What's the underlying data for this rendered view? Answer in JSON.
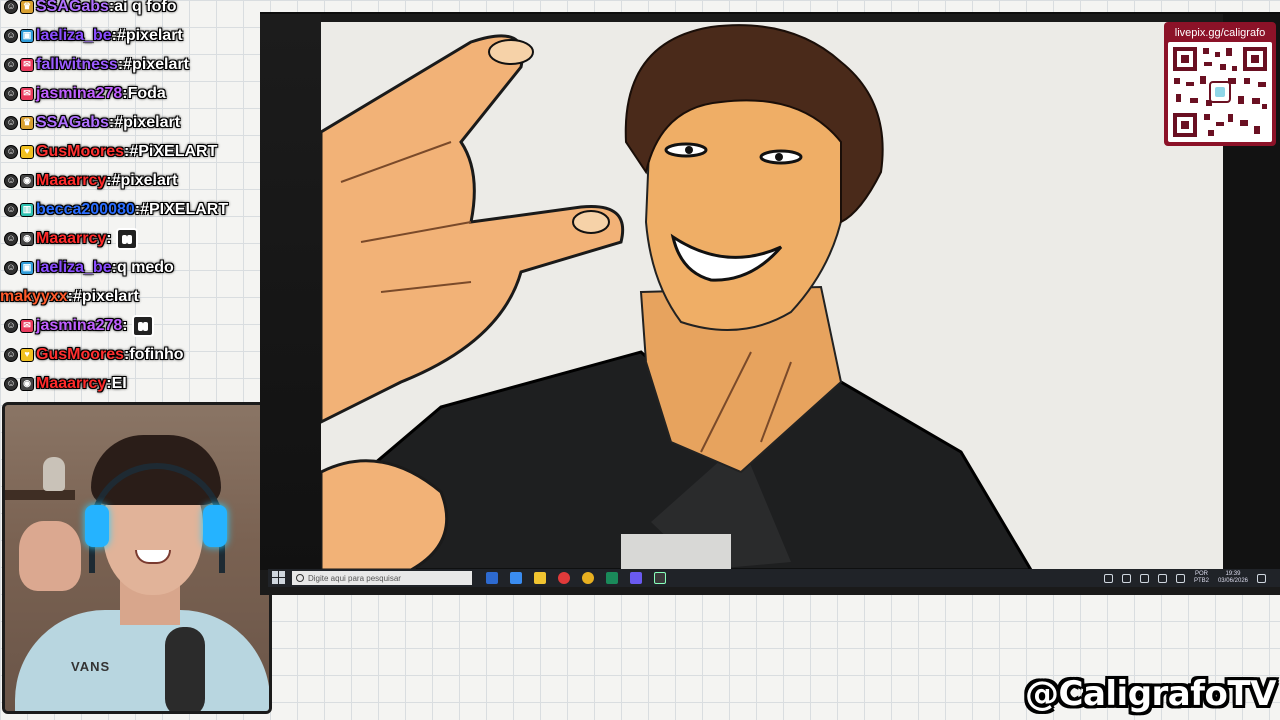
{
  "chat": {
    "messages": [
      {
        "badges": [
          "mod",
          "crown"
        ],
        "user": "SSAGabs",
        "user_color": "#b070ff",
        "message": "ai q fofo",
        "emote": false
      },
      {
        "badges": [
          "mod",
          "prime"
        ],
        "user": "laeliza_be",
        "user_color": "#8a4dff",
        "message": "#pixelart",
        "emote": false
      },
      {
        "badges": [
          "mod",
          "gift"
        ],
        "user": "fallwitness",
        "user_color": "#9b5cff",
        "message": "#pixelart",
        "emote": false
      },
      {
        "badges": [
          "mod",
          "gift"
        ],
        "user": "jasmina278",
        "user_color": "#c060ff",
        "message": "Foda",
        "emote": false
      },
      {
        "badges": [
          "mod",
          "crown"
        ],
        "user": "SSAGabs",
        "user_color": "#b070ff",
        "message": "#pixelart",
        "emote": false
      },
      {
        "badges": [
          "mod",
          "heart"
        ],
        "user": "GusMoores",
        "user_color": "#ff3030",
        "message": "#PiXELART",
        "emote": false
      },
      {
        "badges": [
          "mod",
          "glasses"
        ],
        "user": "Maaarrcy",
        "user_color": "#ff2a2a",
        "message": "#pixelart",
        "emote": false
      },
      {
        "badges": [
          "mod",
          "bars"
        ],
        "user": "becca200080",
        "user_color": "#2a6dff",
        "message": "#PIXELART",
        "emote": false
      },
      {
        "badges": [
          "mod",
          "glasses"
        ],
        "user": "Maaarrcy",
        "user_color": "#ff2a2a",
        "message": "",
        "emote": true
      },
      {
        "badges": [
          "mod",
          "prime"
        ],
        "user": "laeliza_be",
        "user_color": "#8a4dff",
        "message": "q medo",
        "emote": false
      },
      {
        "badges": [],
        "user": "makyyxx",
        "user_color": "#ff5a2a",
        "message": "#pixelart",
        "emote": false
      },
      {
        "badges": [
          "mod",
          "gift"
        ],
        "user": "jasmina278",
        "user_color": "#c060ff",
        "message": "",
        "emote": true
      },
      {
        "badges": [
          "mod",
          "heart"
        ],
        "user": "GusMoores",
        "user_color": "#ff3030",
        "message": "fofinho",
        "emote": false
      },
      {
        "badges": [
          "mod",
          "glasses"
        ],
        "user": "Maaarrcy",
        "user_color": "#ff2a2a",
        "message": "EI",
        "emote": false
      }
    ]
  },
  "webcam": {
    "shirt_text": "VANS"
  },
  "qr": {
    "url": "livepix.gg/caligrafo"
  },
  "taskbar": {
    "search_placeholder": "Digite aqui para pesquisar",
    "lang_line1": "POR",
    "lang_line2": "PTB2",
    "time": "19:39",
    "date": "03/06/2026"
  },
  "overlay": {
    "handle": "@CaligrafoTV"
  },
  "colors": {
    "qr_panel": "#8c1228",
    "taskbar": "#202328",
    "grid_line": "#d9dde0"
  }
}
